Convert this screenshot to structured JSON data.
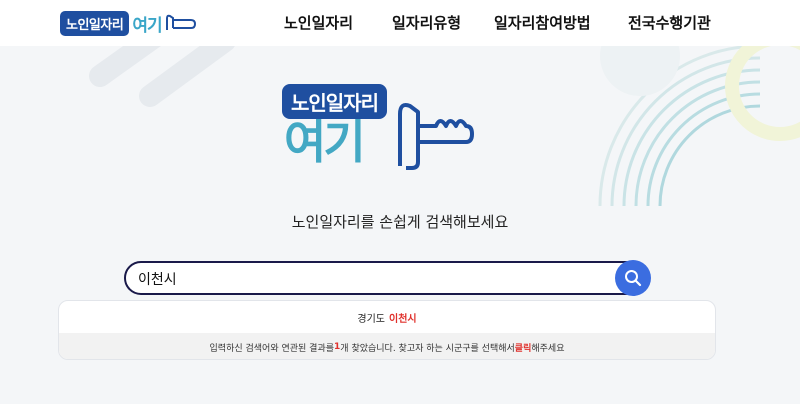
{
  "header": {
    "logo": {
      "badge": "노인일자리",
      "text": "여기"
    },
    "nav": [
      {
        "label": "노인일자리"
      },
      {
        "label": "일자리유형"
      },
      {
        "label": "일자리참여방법"
      },
      {
        "label": "전국수행기관"
      }
    ]
  },
  "hero": {
    "logo": {
      "badge": "노인일자리",
      "text": "여기"
    },
    "subtitle": "노인일자리를 손쉽게 검색해보세요"
  },
  "search": {
    "value": "이천시",
    "icon": "search-icon"
  },
  "results": {
    "items": [
      {
        "province": "경기도",
        "city": "이천시"
      }
    ],
    "message": {
      "prefix": "입력하신 검색어와 연관된 결과를 ",
      "count": "1",
      "middle": "개 찾았습니다. 찾고자 하는 시군구를 선택해서 ",
      "highlight": "클릭",
      "suffix": "해주세요"
    }
  },
  "colors": {
    "brand_blue": "#1f4fa0",
    "brand_teal": "#43a8c4",
    "search_button": "#3b6de0",
    "highlight_red": "#e0302b"
  }
}
